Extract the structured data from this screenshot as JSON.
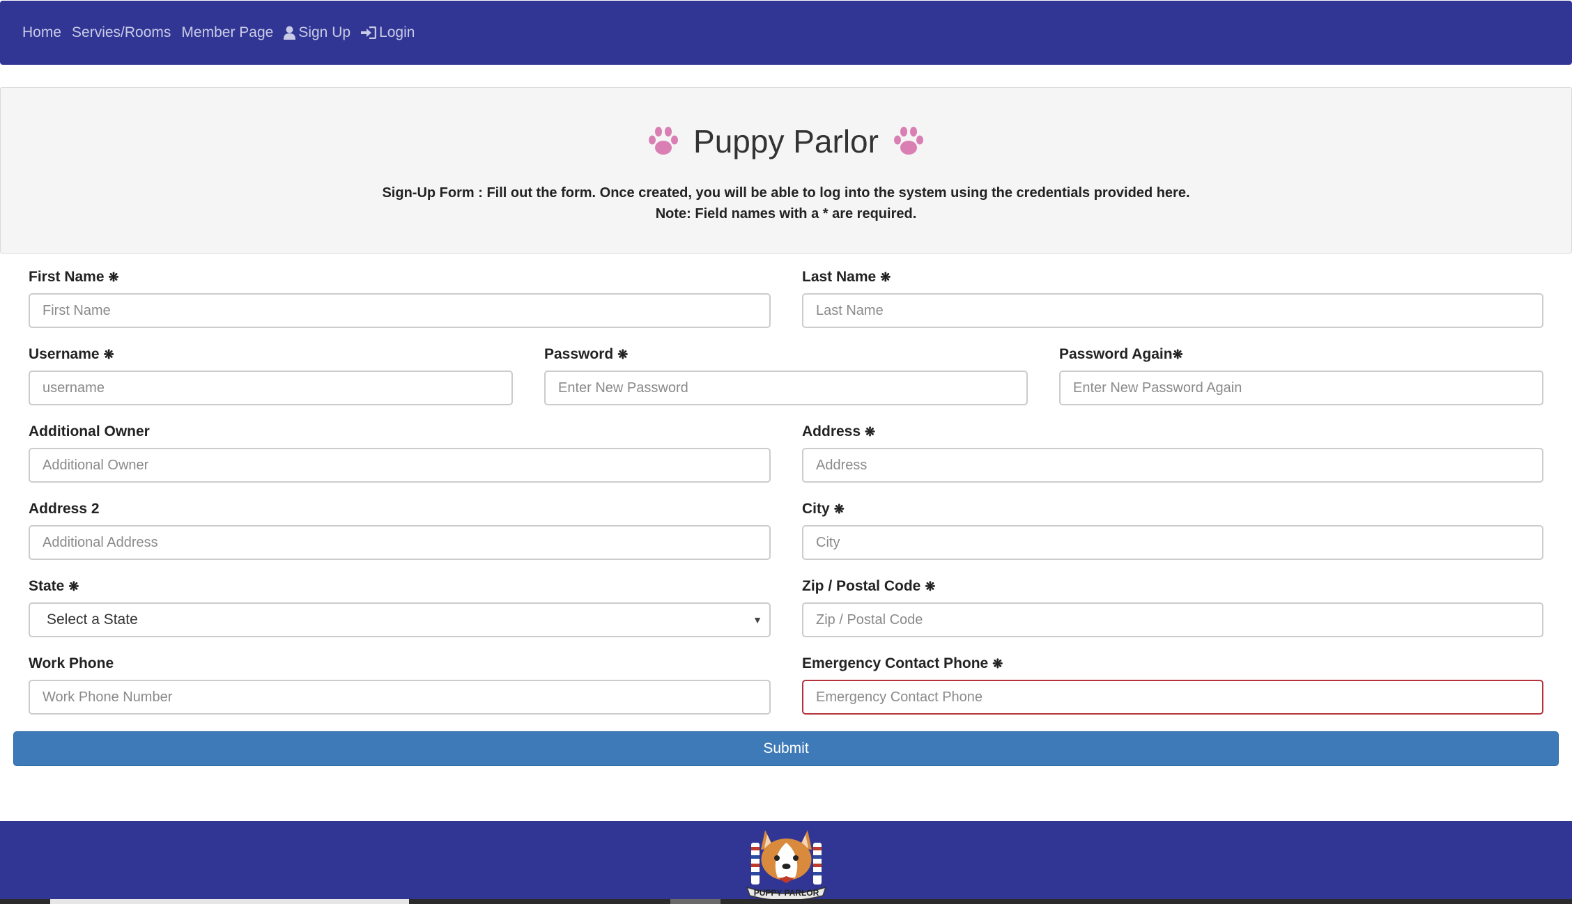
{
  "nav": {
    "home": "Home",
    "services": "Servies/Rooms",
    "member": "Member Page",
    "signup": "Sign Up",
    "login": "Login"
  },
  "header": {
    "title": "Puppy Parlor",
    "intro_line1": "Sign-Up Form : Fill out the form. Once created, you will be able to log into the system using the credentials provided here.",
    "intro_line2": "Note: Field names with a *  are required."
  },
  "form": {
    "required_mark": "❋",
    "first_name": {
      "label": "First Name",
      "placeholder": "First Name"
    },
    "last_name": {
      "label": "Last Name",
      "placeholder": "Last Name"
    },
    "username": {
      "label": "Username",
      "placeholder": "username"
    },
    "password": {
      "label": "Password",
      "placeholder": "Enter New Password"
    },
    "password_again": {
      "label": "Password Again",
      "placeholder": "Enter New Password Again"
    },
    "additional_owner": {
      "label": "Additional Owner",
      "placeholder": "Additional Owner"
    },
    "address": {
      "label": "Address",
      "placeholder": "Address"
    },
    "address2": {
      "label": "Address 2",
      "placeholder": "Additional Address"
    },
    "city": {
      "label": "City",
      "placeholder": "City"
    },
    "state": {
      "label": "State",
      "selected": "Select a State"
    },
    "zip": {
      "label": "Zip / Postal Code",
      "placeholder": "Zip / Postal Code"
    },
    "work_phone": {
      "label": "Work Phone",
      "placeholder": "Work Phone Number"
    },
    "emergency_phone": {
      "label": "Emergency Contact Phone",
      "placeholder": "Emergency Contact Phone"
    },
    "submit_label": "Submit"
  },
  "footer": {
    "logo_text": "PUPPY PARLOR"
  },
  "colors": {
    "nav_bg": "#313694",
    "paw": "#d97fb3",
    "submit_bg": "#3f7ab8",
    "error_border": "#b5323a"
  },
  "icons": {
    "paw": "paw-icon",
    "user": "user-icon",
    "login": "sign-in-icon",
    "select_caret": "caret-down-icon"
  }
}
